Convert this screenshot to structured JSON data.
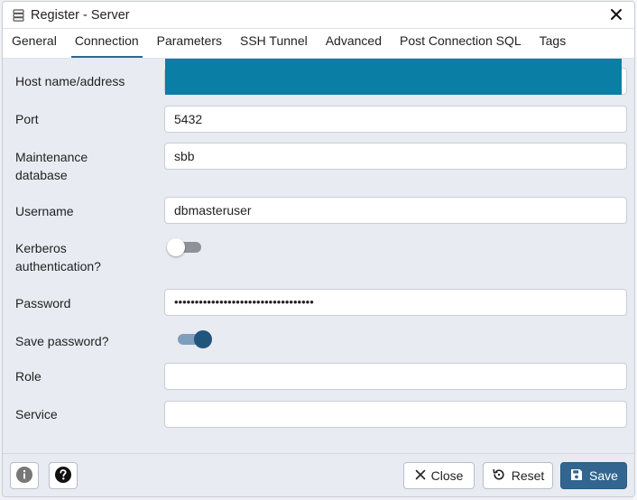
{
  "window": {
    "title": "Register - Server",
    "close_symbol": "✕"
  },
  "tabs": [
    {
      "label": "General"
    },
    {
      "label": "Connection",
      "active": true
    },
    {
      "label": "Parameters"
    },
    {
      "label": "SSH Tunnel"
    },
    {
      "label": "Advanced"
    },
    {
      "label": "Post Connection SQL"
    },
    {
      "label": "Tags"
    }
  ],
  "form": {
    "host": {
      "label": "Host name/address",
      "value": ""
    },
    "port": {
      "label": "Port",
      "value": "5432"
    },
    "maintenance_db": {
      "label_line1": "Maintenance",
      "label_line2": "database",
      "value": "sbb"
    },
    "username": {
      "label": "Username",
      "value": "dbmasteruser"
    },
    "kerberos": {
      "label_line1": "Kerberos",
      "label_line2": "authentication?",
      "enabled": false
    },
    "password": {
      "label": "Password",
      "value": "••••••••••••••••••••••••••••••••••"
    },
    "save_password": {
      "label": "Save password?",
      "enabled": true
    },
    "role": {
      "label": "Role",
      "value": ""
    },
    "service": {
      "label": "Service",
      "value": ""
    }
  },
  "footer": {
    "info_icon": "info-icon",
    "help_icon": "help-icon",
    "close_label": "Close",
    "reset_label": "Reset",
    "save_label": "Save"
  },
  "colors": {
    "accent": "#326690",
    "highlight": "#0a7ea4",
    "toggle_on": "#21557d"
  }
}
